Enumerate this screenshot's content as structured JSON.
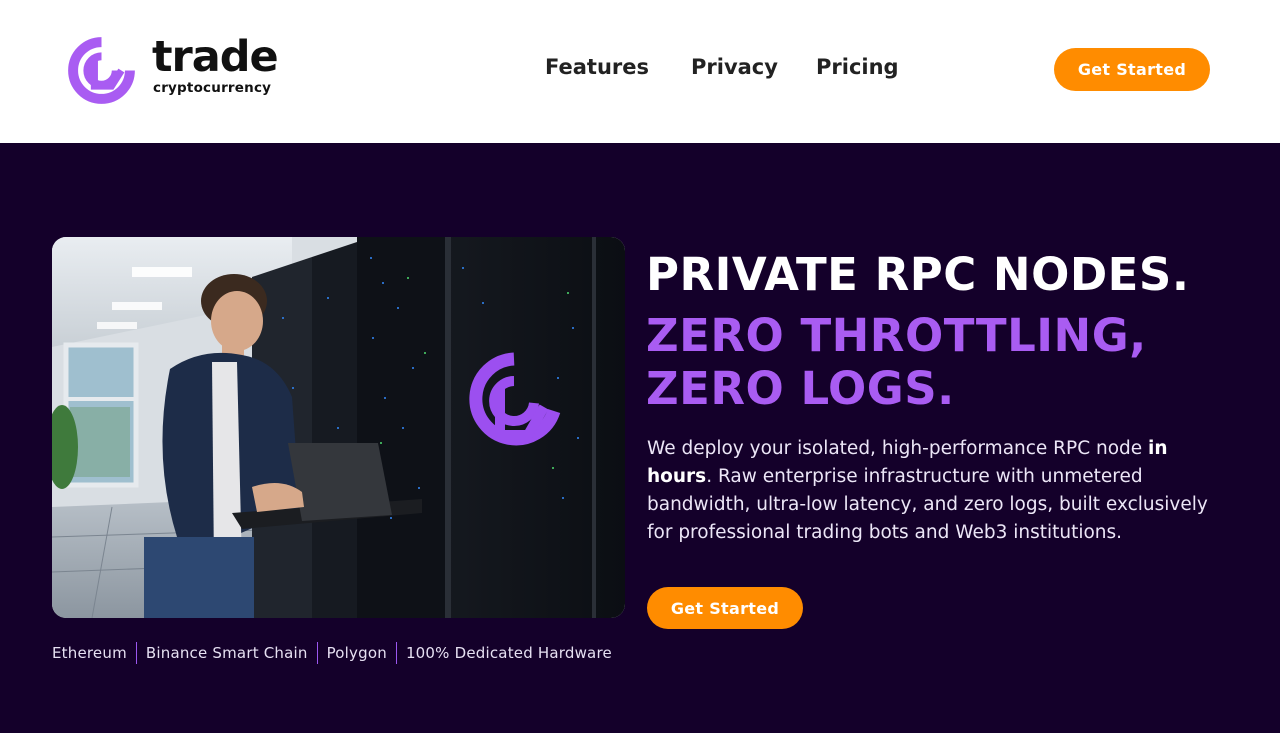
{
  "header": {
    "logo": {
      "word": "trade",
      "sub": "cryptocurrency"
    },
    "nav": [
      "Features",
      "Privacy",
      "Pricing"
    ],
    "cta": "Get Started"
  },
  "hero": {
    "headline": "PRIVATE RPC NODES.",
    "accent_lines": [
      "ZERO THROTTLING,",
      "ZERO LOGS."
    ],
    "description": {
      "before": "We deploy your isolated, high-performance RPC node ",
      "bold": "in hours",
      "after": ". Raw enterprise infrastructure with unmetered bandwidth, ultra-low latency, and zero logs, built exclusively for professional trading bots and Web3 institutions."
    },
    "cta": "Get Started",
    "tags": [
      "Ethereum",
      "Binance Smart Chain",
      "Polygon",
      "100% Dedicated Hardware"
    ]
  },
  "colors": {
    "accent_purple": "#a95cf2",
    "cta_orange": "#ff8c00",
    "hero_bg": "#14002a"
  }
}
